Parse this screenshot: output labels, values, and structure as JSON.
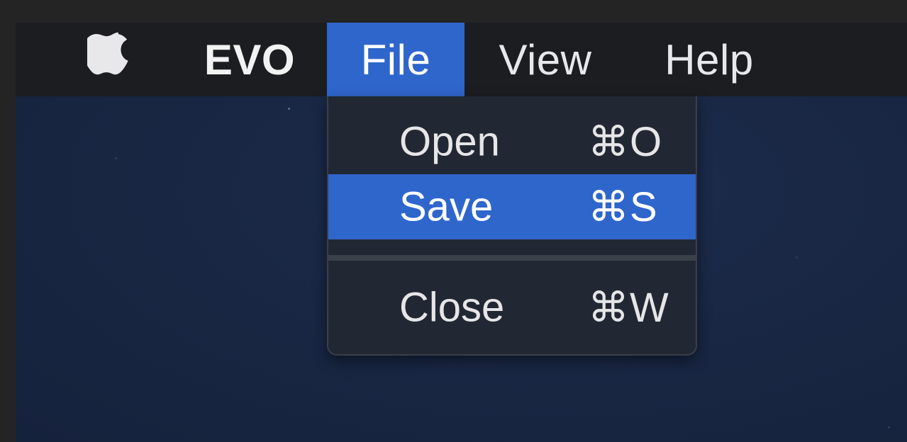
{
  "menubar": {
    "apple_icon": "apple-logo-icon",
    "app_name": "EVO",
    "menus": [
      {
        "label": "File"
      },
      {
        "label": "View"
      },
      {
        "label": "Help"
      }
    ]
  },
  "file_menu": {
    "items": [
      {
        "label": "Open",
        "shortcut": "⌘O"
      },
      {
        "label": "Save",
        "shortcut": "⌘S"
      },
      {
        "label": "Close",
        "shortcut": "⌘W"
      }
    ],
    "highlighted": "Save"
  },
  "colors": {
    "menubar_bg": "#1c1d20",
    "selection": "#2f66cc",
    "menu_bg": "#222833",
    "desktop_bg": "#192744"
  }
}
